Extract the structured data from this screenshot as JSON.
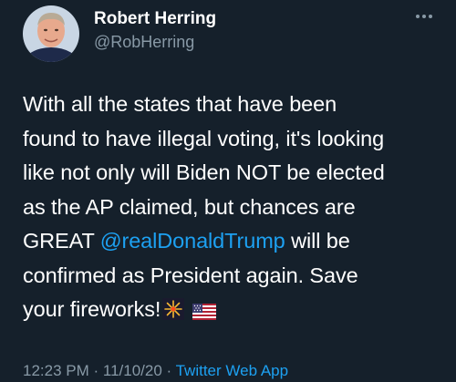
{
  "author": {
    "display_name": "Robert Herring",
    "handle": "@RobHerring"
  },
  "tweet": {
    "line1": "With all the states that have been",
    "line2": "found to have illegal voting, it's looking",
    "line3": "like not only will Biden NOT be elected",
    "line4": "as the AP claimed, but chances are",
    "line5_before": "GREAT ",
    "line5_mention": "@realDonaldTrump",
    "line5_after": " will be",
    "line6": "confirmed as President again. Save",
    "line7": "your fireworks!",
    "emojis": [
      "fireworks-emoji",
      "us-flag-emoji"
    ]
  },
  "meta": {
    "time": "12:23 PM",
    "separator": " · ",
    "date": "11/10/20",
    "source": "Twitter Web App"
  },
  "icons": {
    "more": "more-options-icon"
  },
  "colors": {
    "background": "#15202b",
    "text": "#ffffff",
    "secondary": "#8899a6",
    "link": "#1da1f2"
  }
}
